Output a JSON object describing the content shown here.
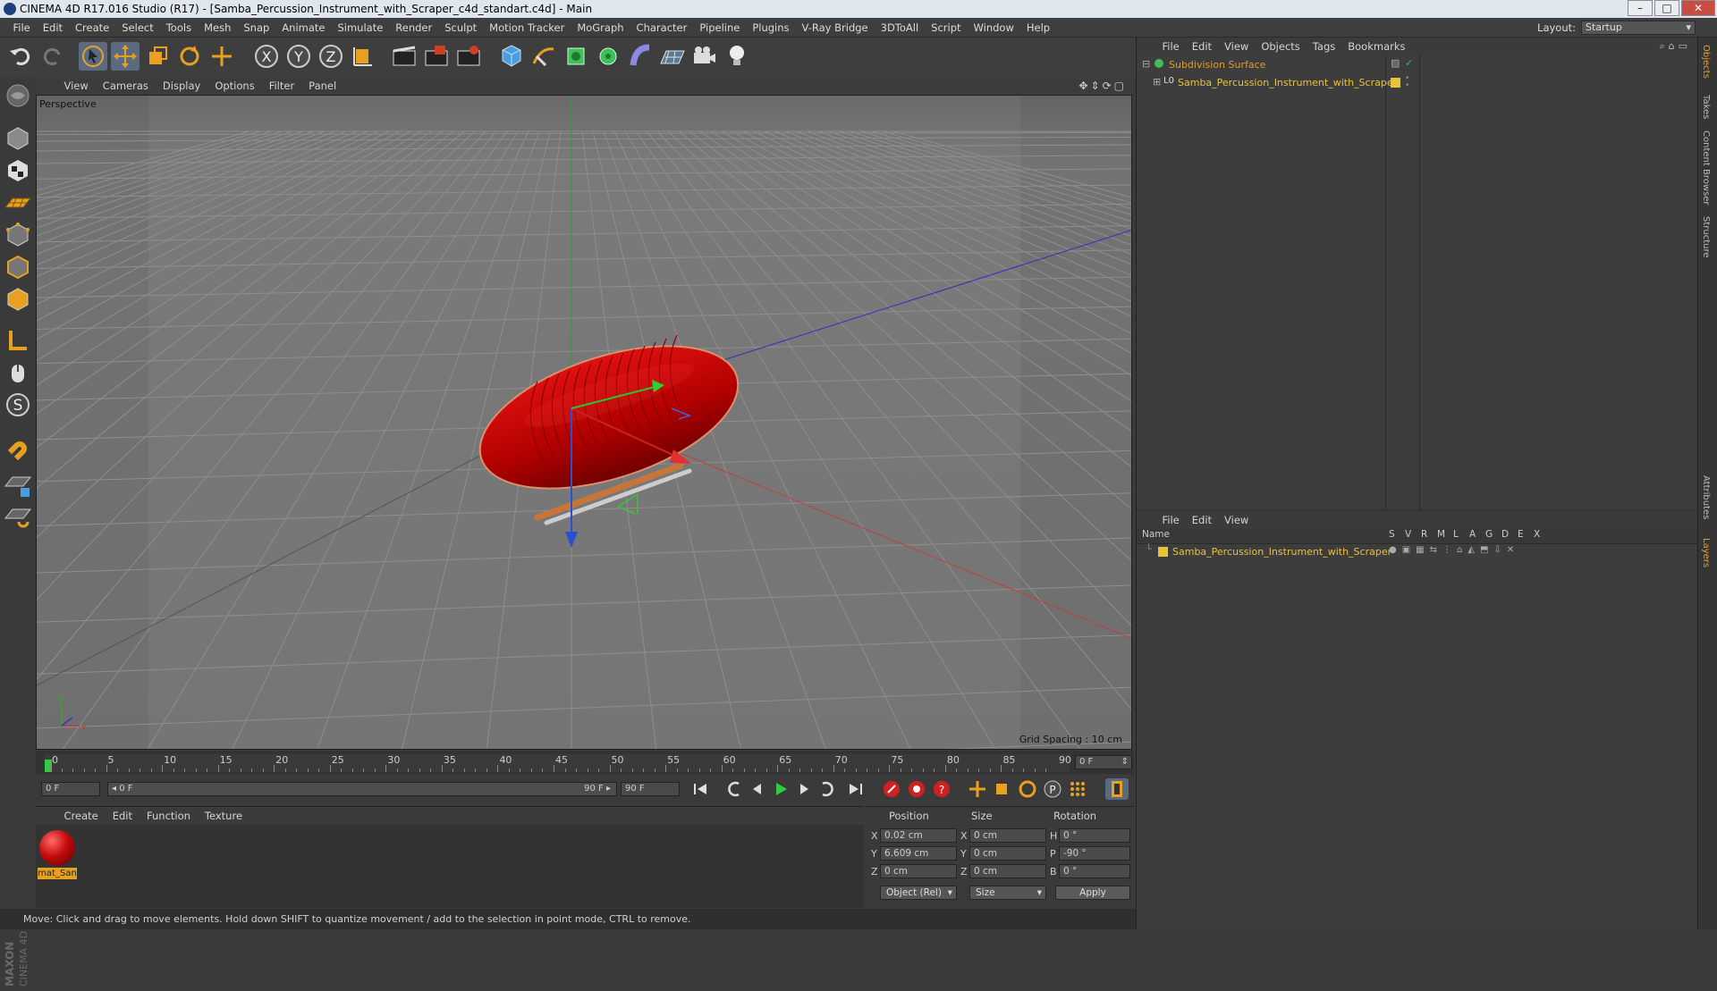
{
  "window": {
    "title": "CINEMA 4D R17.016 Studio (R17) - [Samba_Percussion_Instrument_with_Scraper_c4d_standart.c4d] - Main",
    "minimize": "–",
    "maximize": "□",
    "close": "✕"
  },
  "menu": {
    "items": [
      "File",
      "Edit",
      "Create",
      "Select",
      "Tools",
      "Mesh",
      "Snap",
      "Animate",
      "Simulate",
      "Render",
      "Sculpt",
      "Motion Tracker",
      "MoGraph",
      "Character",
      "Pipeline",
      "Plugins",
      "V-Ray Bridge",
      "3DToAll",
      "Script",
      "Window",
      "Help"
    ],
    "layout_label": "Layout:",
    "layout_value": "Startup"
  },
  "viewport": {
    "menu": [
      "View",
      "Cameras",
      "Display",
      "Options",
      "Filter",
      "Panel"
    ],
    "label": "Perspective",
    "grid_spacing": "Grid Spacing : 10 cm"
  },
  "timeline": {
    "ticks": [
      "0",
      "5",
      "10",
      "15",
      "20",
      "25",
      "30",
      "35",
      "40",
      "45",
      "50",
      "55",
      "60",
      "65",
      "70",
      "75",
      "80",
      "85",
      "90"
    ],
    "current_frame": "0 F"
  },
  "transport": {
    "start_field": "0 F",
    "range_start": "◂ 0 F",
    "range_end": "90 F ▸",
    "end_field": "90 F"
  },
  "material_manager": {
    "menu": [
      "Create",
      "Edit",
      "Function",
      "Texture"
    ],
    "material_name": "mat_San",
    "material_color": "#c40c0c"
  },
  "coordinates": {
    "headers": {
      "position": "Position",
      "size": "Size",
      "rotation": "Rotation"
    },
    "rows": [
      {
        "axis": "X",
        "pos": "0.02 cm",
        "size_axis": "X",
        "size": "0 cm",
        "rot_axis": "H",
        "rot": "0 °"
      },
      {
        "axis": "Y",
        "pos": "6.609 cm",
        "size_axis": "Y",
        "size": "0 cm",
        "rot_axis": "P",
        "rot": "-90 °"
      },
      {
        "axis": "Z",
        "pos": "0 cm",
        "size_axis": "Z",
        "size": "0 cm",
        "rot_axis": "B",
        "rot": "0 °"
      }
    ],
    "mode_dropdown": "Object (Rel)",
    "size_dropdown": "Size",
    "apply": "Apply"
  },
  "status": "Move: Click and drag to move elements. Hold down SHIFT to quantize movement / add to the selection in point mode, CTRL to remove.",
  "objects_panel": {
    "menu": [
      "File",
      "Edit",
      "View",
      "Objects",
      "Tags",
      "Bookmarks"
    ],
    "items": [
      {
        "name": "Subdivision Surface",
        "color": "#e49a28"
      },
      {
        "name": "Samba_Percussion_Instrument_with_Scraper",
        "color": "#e8c23a"
      }
    ]
  },
  "layers_panel": {
    "menu": [
      "File",
      "Edit",
      "View"
    ],
    "columns": [
      "Name",
      "S",
      "V",
      "R",
      "M",
      "L",
      "A",
      "G",
      "D",
      "E",
      "X"
    ],
    "layer_name": "Samba_Percussion_Instrument_with_Scraper",
    "layer_color": "#e8c23a"
  },
  "side_tabs": [
    "Objects",
    "Takes",
    "Content Browser",
    "Structure",
    "Attributes",
    "Layers"
  ],
  "maxon_logo": "MAXON CINEMA 4D"
}
